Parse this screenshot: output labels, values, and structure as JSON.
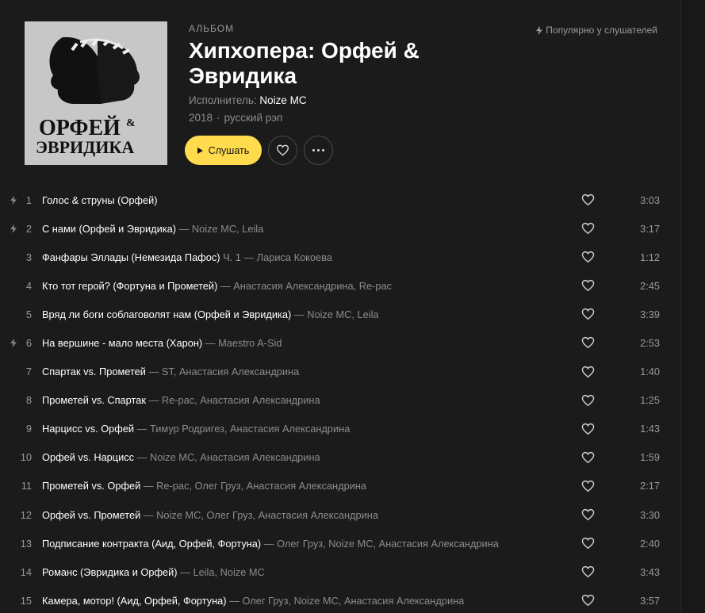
{
  "header": {
    "type_label": "Альбом",
    "title": "Хипхопера: Орфей & Эвридика",
    "artist_prefix": "Исполнитель:",
    "artist": "Noize MC",
    "year": "2018",
    "genre": "русский рэп",
    "popular_label": "Популярно у слушателей",
    "listen_label": "Слушать",
    "cover_text_line1": "ОРФЕЙ",
    "cover_text_amp": "&",
    "cover_text_line2": "ЭВРИДИКА"
  },
  "tracks": [
    {
      "num": "1",
      "title": "Голос & струны (Орфей)",
      "version": "",
      "artists": "",
      "duration": "3:03",
      "popular": true
    },
    {
      "num": "2",
      "title": "С нами (Орфей и Эвридика)",
      "version": "",
      "artists": "— Noize MC, Leila",
      "duration": "3:17",
      "popular": true
    },
    {
      "num": "3",
      "title": "Фанфары Эллады (Немезида Пафос)",
      "version": "Ч. 1",
      "artists": "— Лариса Кокоева",
      "duration": "1:12",
      "popular": false
    },
    {
      "num": "4",
      "title": "Кто тот герой? (Фортуна и Прометей)",
      "version": "",
      "artists": "— Анастасия Александрина, Re-pac",
      "duration": "2:45",
      "popular": false
    },
    {
      "num": "5",
      "title": "Вряд ли боги соблаговолят нам (Орфей и Эвридика)",
      "version": "",
      "artists": "— Noize MC, Leila",
      "duration": "3:39",
      "popular": false
    },
    {
      "num": "6",
      "title": "На вершине - мало места (Харон)",
      "version": "",
      "artists": "— Maestro A-Sid",
      "duration": "2:53",
      "popular": true
    },
    {
      "num": "7",
      "title": "Спартак vs. Прометей",
      "version": "",
      "artists": "— ST, Анастасия Александрина",
      "duration": "1:40",
      "popular": false
    },
    {
      "num": "8",
      "title": "Прометей vs. Спартак",
      "version": "",
      "artists": "— Re-pac, Анастасия Александрина",
      "duration": "1:25",
      "popular": false
    },
    {
      "num": "9",
      "title": "Нарцисс vs. Орфей",
      "version": "",
      "artists": "— Тимур Родригез, Анастасия Александрина",
      "duration": "1:43",
      "popular": false
    },
    {
      "num": "10",
      "title": "Орфей vs. Нарцисс",
      "version": "",
      "artists": "— Noize MC, Анастасия Александрина",
      "duration": "1:59",
      "popular": false
    },
    {
      "num": "11",
      "title": "Прометей vs. Орфей",
      "version": "",
      "artists": "— Re-pac, Олег Груз, Анастасия Александрина",
      "duration": "2:17",
      "popular": false
    },
    {
      "num": "12",
      "title": "Орфей vs. Прометей",
      "version": "",
      "artists": "— Noize MC, Олег Груз, Анастасия Александрина",
      "duration": "3:30",
      "popular": false
    },
    {
      "num": "13",
      "title": "Подписание контракта (Аид, Орфей, Фортуна)",
      "version": "",
      "artists": "— Олег Груз, Noize MC, Анастасия Александрина",
      "duration": "2:40",
      "popular": false
    },
    {
      "num": "14",
      "title": "Романс (Эвридика и Орфей)",
      "version": "",
      "artists": "— Leila, Noize MC",
      "duration": "3:43",
      "popular": false
    },
    {
      "num": "15",
      "title": "Камера, мотор! (Аид, Орфей, Фортуна)",
      "version": "",
      "artists": "— Олег Груз, Noize MC, Анастасия Александрина",
      "duration": "3:57",
      "popular": false
    }
  ],
  "colors": {
    "background": "#1b1b1b",
    "accent": "#ffdb4d",
    "muted_text": "#8c8c8c"
  }
}
